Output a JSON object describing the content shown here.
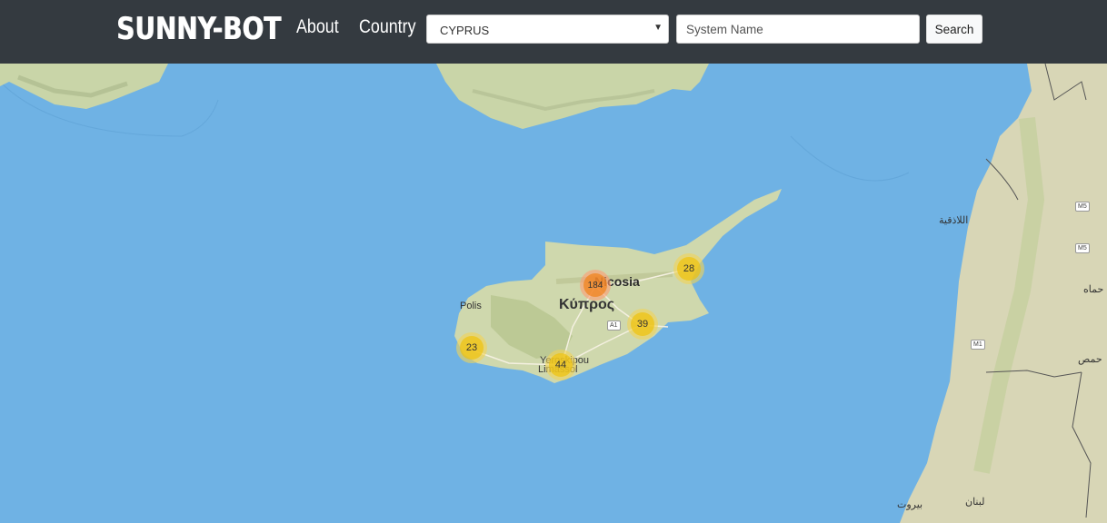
{
  "nav": {
    "brand": "SUNNY-BOT",
    "about": "About",
    "country": "Country"
  },
  "country_select": {
    "value": "CYPRUS"
  },
  "system_input": {
    "placeholder": "System Name"
  },
  "search_button": {
    "label": "Search"
  },
  "map": {
    "labels": {
      "nicosia": "Nicosia",
      "kypros": "Κύπρος",
      "polis": "Polis",
      "yeroskipou": "Yeroskipou",
      "limassol": "Limassol",
      "latakia": "اللاذقية",
      "hama": "حماه",
      "homs": "حمص",
      "beirut": "بيروت",
      "lebanon": "لبنان"
    },
    "roads": {
      "a1": "A1",
      "m5a": "M5",
      "m5b": "M5",
      "m1": "M1"
    },
    "clusters": [
      {
        "id": "nicosia",
        "count": "184",
        "level": "medium"
      },
      {
        "id": "east",
        "count": "28",
        "level": "small"
      },
      {
        "id": "larnaca",
        "count": "39",
        "level": "small"
      },
      {
        "id": "paphos",
        "count": "23",
        "level": "small"
      },
      {
        "id": "limassol",
        "count": "44",
        "level": "small"
      }
    ]
  }
}
